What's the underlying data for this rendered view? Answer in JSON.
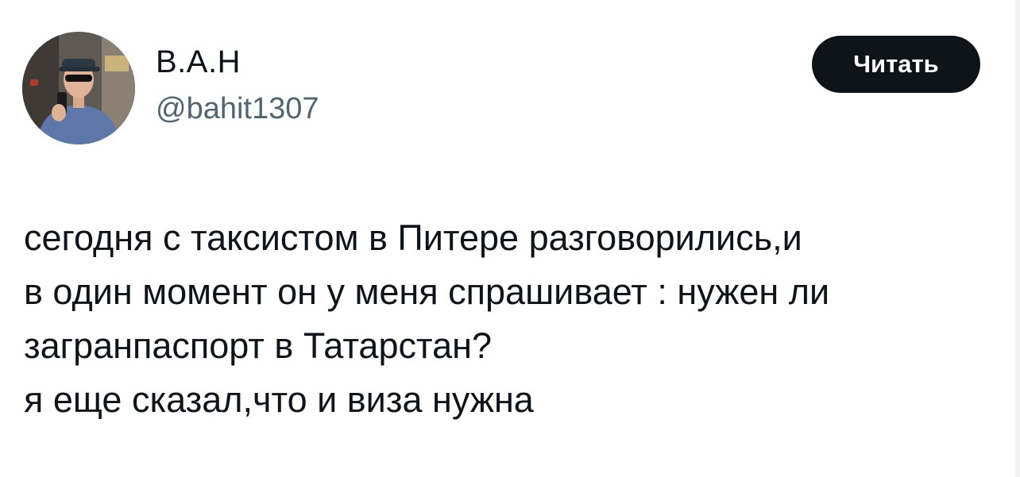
{
  "author": {
    "display_name": "В.А.Н",
    "handle": "@bahit1307"
  },
  "follow_button": {
    "label": "Читать"
  },
  "tweet": {
    "lines": [
      "сегодня с таксистом в Питере разговорились,и",
      "в один момент он у меня спрашивает : нужен ли",
      "загранпаспорт в Татарстан?",
      "я еще сказал,что и виза нужна"
    ]
  },
  "colors": {
    "text_primary": "#0f1419",
    "text_secondary": "#536471",
    "button_bg": "#0f1419",
    "button_text": "#ffffff"
  }
}
